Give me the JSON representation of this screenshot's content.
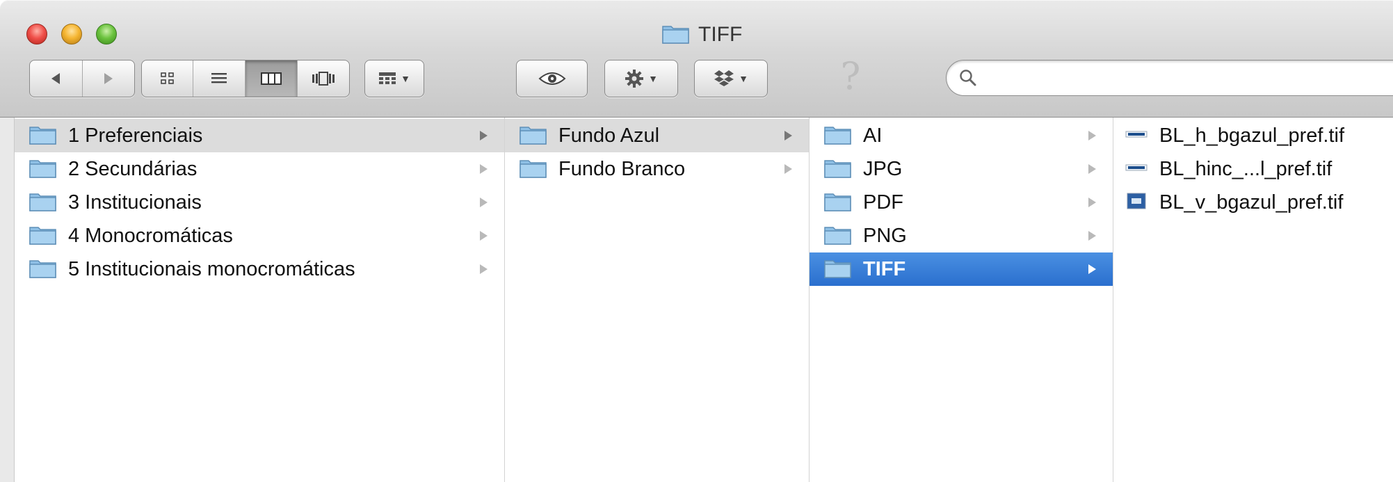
{
  "window": {
    "title": "TIFF"
  },
  "toolbar": {
    "search": {
      "placeholder": "",
      "value": ""
    },
    "help_glyph": "?"
  },
  "columns": [
    {
      "items": [
        {
          "label": "1 Preferenciais",
          "state": "path-selected"
        },
        {
          "label": "2 Secundárias"
        },
        {
          "label": "3 Institucionais"
        },
        {
          "label": "4 Monocromáticas"
        },
        {
          "label": "5 Institucionais monocromáticas"
        }
      ]
    },
    {
      "items": [
        {
          "label": "Fundo Azul",
          "state": "path-selected"
        },
        {
          "label": "Fundo Branco"
        }
      ]
    },
    {
      "items": [
        {
          "label": "AI"
        },
        {
          "label": "JPG"
        },
        {
          "label": "PDF"
        },
        {
          "label": "PNG"
        },
        {
          "label": "TIFF",
          "state": "selected"
        }
      ]
    },
    {
      "items": [
        {
          "label": "BL_h_bgazul_pref.tif",
          "icon": "horizontal-logo-file-icon"
        },
        {
          "label": "BL_hinc_...l_pref.tif",
          "icon": "horizontal-logo-file-icon"
        },
        {
          "label": "BL_v_bgazul_pref.tif",
          "icon": "vertical-logo-file-icon"
        }
      ]
    }
  ],
  "colors": {
    "selection_blue": "#3a80d8",
    "path_gray": "#dcdcdc",
    "folder_blue": "#8fc0e6"
  }
}
